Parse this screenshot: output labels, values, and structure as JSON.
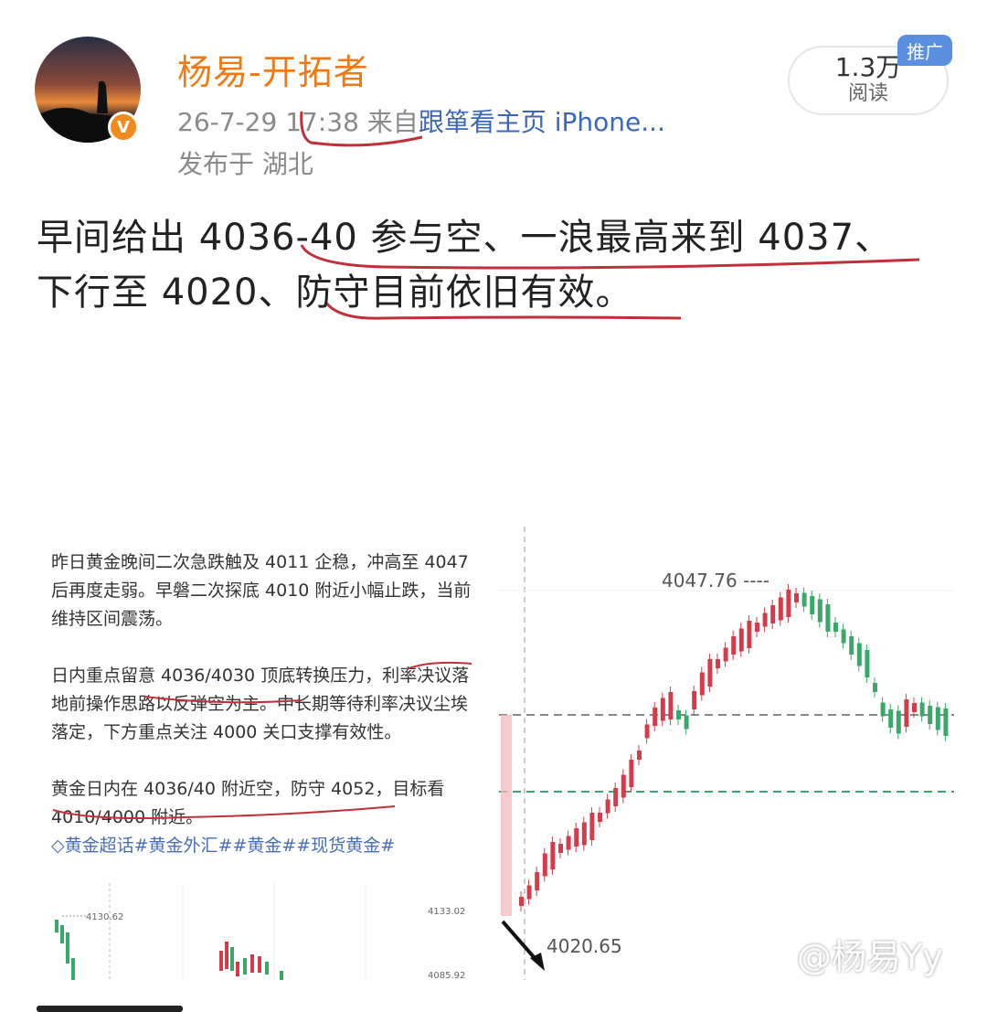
{
  "post": {
    "author": "杨易-开拓者",
    "date": "26-7-29",
    "time": "17:38",
    "from_label": "来自",
    "source": "跟箪看主页 iPhone...",
    "location": "发布于 湖北",
    "read_count": "1.3万",
    "read_label": "阅读",
    "promo_badge": "推广",
    "verified_badge": "V",
    "text_line1": "早间给出 4036-40 参与空、一浪最高来到 4037、",
    "text_line2": "下行至 4020、防守目前依旧有效。"
  },
  "embedded_image": {
    "paragraph1": "昨日黄金晚间二次急跌触及 4011 企稳，冲高至 4047 后再度走弱。早磐二次探底 4010 附近小幅止跌，当前维持区间震荡。",
    "paragraph2": "日内重点留意 4036/4030 顶底转换压力，利率决议落地前操作思路以反弹空为主。中长期等待利率决议尘埃落定，下方重点关注 4000 关口支撑有效性。",
    "paragraph3": "黄金日内在 4036/40 附近空，防守 4052，目标看 4010/4000 附近。",
    "tags": "◇黄金超话#黄金外汇##黄金##现货黄金#",
    "mini_chart_high": "4130.62",
    "mini_chart_axis_top": "4133.02",
    "mini_chart_axis_bottom": "4085.92",
    "chart_high_label": "4047.76 ----",
    "chart_low_label": "4020.65",
    "watermark": "@杨易Yy",
    "colors": {
      "up": "#d43c4c",
      "down": "#3aa86a",
      "accent": "#ef7a15",
      "link": "#3c67b8",
      "annotation": "#c0303a"
    }
  }
}
